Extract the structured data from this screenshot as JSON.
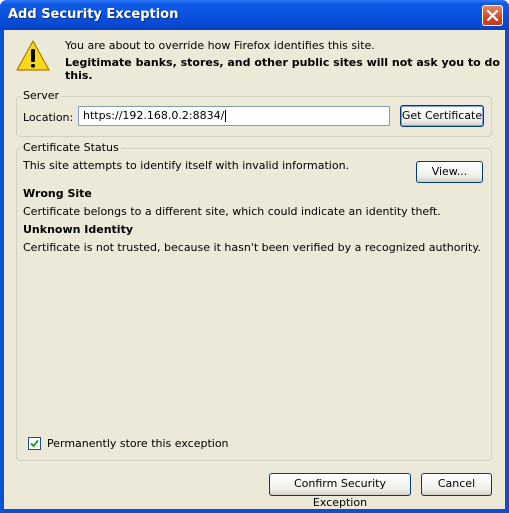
{
  "window": {
    "title": "Add Security Exception"
  },
  "warning": {
    "line1": "You are about to override how Firefox identifies this site.",
    "line2": "Legitimate banks, stores, and other public sites will not ask you to do this."
  },
  "server": {
    "legend": "Server",
    "location_label": "Location:",
    "location_value": "https://192.168.0.2:8834/",
    "get_certificate": "Get Certificate"
  },
  "status": {
    "legend": "Certificate Status",
    "message": "This site attempts to identify itself with invalid information.",
    "view": "View...",
    "wrong_site_heading": "Wrong Site",
    "wrong_site_text": "Certificate belongs to a different site, which could indicate an identity theft.",
    "unknown_identity_heading": "Unknown Identity",
    "unknown_identity_text": "Certificate is not trusted, because it hasn't been verified by a recognized authority."
  },
  "permanent": {
    "label": "Permanently store this exception",
    "checked": true
  },
  "buttons": {
    "confirm": "Confirm Security Exception",
    "cancel": "Cancel"
  },
  "icons": [
    "warning-icon",
    "close-icon",
    "checkmark-icon"
  ],
  "colors": {
    "titlebar": "#0a52e0",
    "dialog_bg": "#ece9d8",
    "close": "#d24a25"
  }
}
